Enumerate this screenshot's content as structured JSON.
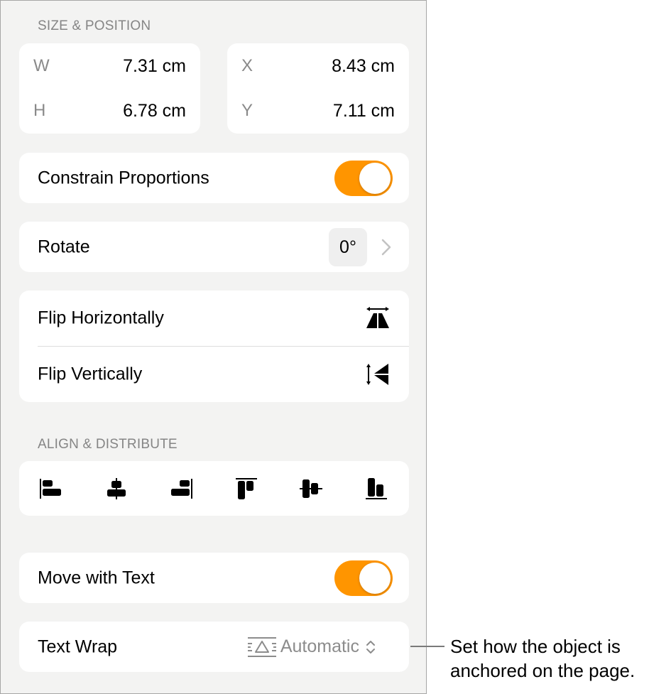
{
  "size_position": {
    "header": "SIZE & POSITION",
    "size": [
      {
        "label": "W",
        "value": "7.31 cm"
      },
      {
        "label": "H",
        "value": "6.78 cm"
      }
    ],
    "position": [
      {
        "label": "X",
        "value": "8.43 cm"
      },
      {
        "label": "Y",
        "value": "7.11 cm"
      }
    ]
  },
  "constrain": {
    "label": "Constrain Proportions",
    "on": true
  },
  "rotate": {
    "label": "Rotate",
    "value": "0°",
    "icon": "chevron-right-icon"
  },
  "flip": [
    {
      "label": "Flip Horizontally",
      "icon": "flip-horizontal-icon"
    },
    {
      "label": "Flip Vertically",
      "icon": "flip-vertical-icon"
    }
  ],
  "align": {
    "header": "ALIGN & DISTRIBUTE",
    "buttons": [
      {
        "name": "align-left",
        "icon": "align-left-icon"
      },
      {
        "name": "align-center",
        "icon": "align-center-icon"
      },
      {
        "name": "align-right",
        "icon": "align-right-icon"
      },
      {
        "name": "align-top",
        "icon": "align-top-icon"
      },
      {
        "name": "align-middle",
        "icon": "align-middle-icon"
      },
      {
        "name": "align-bottom",
        "icon": "align-bottom-icon"
      }
    ]
  },
  "move_with_text": {
    "label": "Move with Text",
    "on": true
  },
  "text_wrap": {
    "label": "Text Wrap",
    "value": "Automatic",
    "icon": "text-wrap-automatic-icon"
  },
  "callout": {
    "text": "Set how the object is anchored on the page."
  },
  "colors": {
    "accent": "#ff9500",
    "panel_bg": "#f3f3f2",
    "card_bg": "#ffffff",
    "secondary_text": "#858585"
  }
}
